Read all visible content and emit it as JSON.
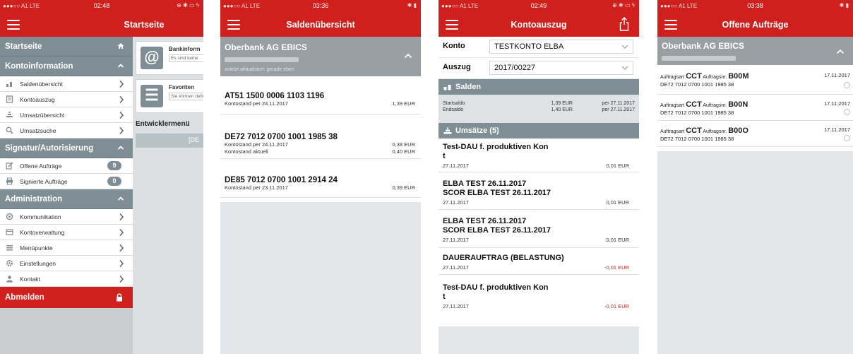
{
  "status": {
    "carrier": "●●●○○ A1  LTE",
    "panels": [
      {
        "time": "02:48",
        "right": "⊕ ✱ ▭ ϟ"
      },
      {
        "time": "03:36",
        "right": "✱ ▮"
      },
      {
        "time": "02:49",
        "right": "⊕ ✱ ▭ ϟ"
      },
      {
        "time": "03:38",
        "right": "✱ ▮"
      }
    ]
  },
  "p1": {
    "title": "Startseite",
    "sections": {
      "start": "Startseite",
      "konto": "Kontoinformation",
      "signatur": "Signatur/Autorisierung",
      "admin": "Administration"
    },
    "items": {
      "saldo": "Saldenübersicht",
      "auszug": "Kontoauszug",
      "umsatz": "Umsatzübersicht",
      "suche": "Umsatzsuche",
      "offene": "Offene Aufträge",
      "signierte": "Signierte Aufträge",
      "komm": "Kommunikation",
      "kontoverw": "Kontoverwaltung",
      "menue": "Menüpunkte",
      "einst": "Einstellungen",
      "kontakt": "Kontakt"
    },
    "badges": {
      "offene": "9",
      "signierte": "0"
    },
    "logout": "Abmelden",
    "behind": {
      "tile1_title": "Bankinform",
      "tile1_sub": "Es sind keine",
      "tile2_title": "Favoriten",
      "tile2_sub": "Sie können definieren.",
      "dev": "Entwicklermenü",
      "devbtn": "[DE"
    }
  },
  "p2": {
    "title": "Saldenübersicht",
    "bank": "Oberbank AG EBICS",
    "updated": "zuletzt aktualisiert: gerade eben",
    "accounts": [
      {
        "iban": "AT51 1500 0006 1103 1196",
        "l1": "Kontostand per 24.11.2017",
        "a1": "1,39 EUR"
      },
      {
        "iban": "DE72 7012 0700 1001 1985 38",
        "l1": "Kontostand per 24.11.2017",
        "a1": "0,38 EUR",
        "l2": "Kontostand aktuell",
        "a2": "0,40 EUR"
      },
      {
        "iban": "DE85 7012 0700 1001 2914 24",
        "l1": "Kontostand per 23.11.2017",
        "a1": "0,39 EUR"
      }
    ]
  },
  "p3": {
    "title": "Kontoauszug",
    "konto_label": "Konto",
    "konto_value": "TESTKONTO ELBA",
    "auszug_label": "Auszug",
    "auszug_value": "2017/00227",
    "salden_label": "Salden",
    "start_label": "Startsaldo",
    "start_amt": "1,39 EUR",
    "start_date": "per 27.11.2017",
    "end_label": "Endsaldo",
    "end_amt": "1,40 EUR",
    "end_date": "per 27.11.2017",
    "umsaetze_label": "Umsätze (5)",
    "tx": [
      {
        "l1": "Test-DAU f. produktiven Kon",
        "l2": "t",
        "date": "27.11.2017",
        "amt": "0,01 EUR"
      },
      {
        "l1": "ELBA TEST 26.11.2017",
        "l2": "SCOR ELBA TEST 26.11.2017",
        "date": "27.11.2017",
        "amt": "0,01 EUR"
      },
      {
        "l1": "ELBA TEST 26.11.2017",
        "l2": "SCOR ELBA TEST 26.11.2017",
        "date": "27.11.2017",
        "amt": "0,01 EUR"
      },
      {
        "l1": "DAUERAUFTRAG (BELASTUNG)",
        "l2": "",
        "date": "27.11.2017",
        "amt": "-0,01 EUR"
      },
      {
        "l1": "Test-DAU f. produktiven Kon",
        "l2": "t",
        "date": "27.11.2017",
        "amt": "-0,01 EUR"
      }
    ]
  },
  "p4": {
    "title": "Offene Aufträge",
    "bank": "Oberbank AG EBICS",
    "art_label": "Auftragsart",
    "nr_label": "Auftragsnr.",
    "orders": [
      {
        "art": "CCT",
        "nr": "B00M",
        "iban": "DE72 7012 0700 1001 1985 38",
        "date": "17.11.2017"
      },
      {
        "art": "CCT",
        "nr": "B00N",
        "iban": "DE72 7012 0700 1001 1985 38",
        "date": "17.11.2017"
      },
      {
        "art": "CCT",
        "nr": "B00O",
        "iban": "DE72 7012 0700 1001 1985 38",
        "date": "17.11.2017"
      }
    ]
  },
  "colors": {
    "brand": "#d0201e",
    "section": "#7f8d95",
    "header_gray": "#999fa3",
    "negative": "#d0201e"
  }
}
